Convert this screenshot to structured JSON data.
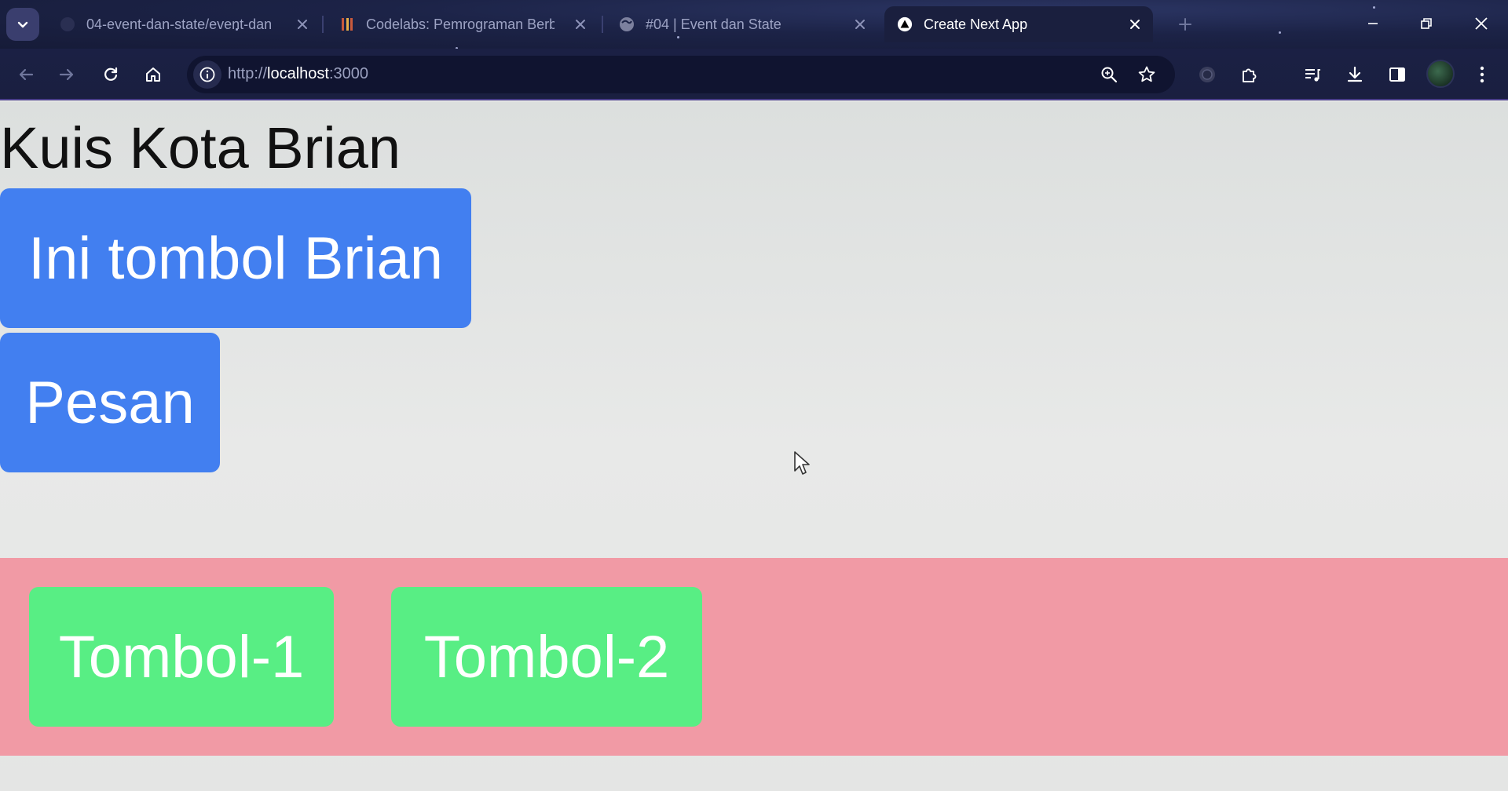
{
  "browser": {
    "tabs": [
      {
        "title": "04-event-dan-state/event-dan",
        "favicon": "github-icon",
        "active": false
      },
      {
        "title": "Codelabs: Pemrograman Berba",
        "favicon": "codelabs-icon",
        "active": false
      },
      {
        "title": "#04 | Event dan State",
        "favicon": "globe-icon",
        "active": false
      },
      {
        "title": "Create Next App",
        "favicon": "nextjs-icon",
        "active": true
      }
    ],
    "url_scheme": "http://",
    "url_host": "localhost",
    "url_port": ":3000"
  },
  "page": {
    "title": "Kuis Kota Brian",
    "buttons": {
      "brian": "Ini tombol Brian",
      "pesan": "Pesan"
    },
    "toolbar": {
      "button1": "Tombol-1",
      "button2": "Tombol-2"
    }
  },
  "colors": {
    "primary_button": "#427ff0",
    "toolbar_background": "#f19aa5",
    "toolbar_button": "#58ee84"
  }
}
